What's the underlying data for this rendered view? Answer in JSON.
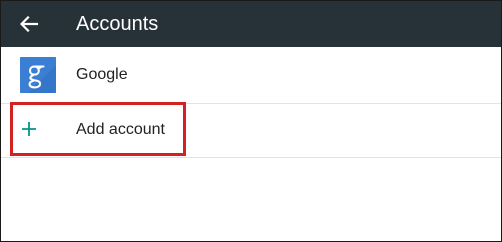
{
  "app_bar": {
    "title": "Accounts",
    "back_icon": "arrow-left-icon",
    "background_color": "#263238"
  },
  "accounts": [
    {
      "label": "Google",
      "icon": "google-logo-icon",
      "icon_color": "#3b7fd4"
    }
  ],
  "add_account": {
    "label": "Add account",
    "icon": "plus-icon",
    "icon_color": "#009688"
  },
  "highlight": {
    "color": "#d42222",
    "target": "add-account-row"
  }
}
